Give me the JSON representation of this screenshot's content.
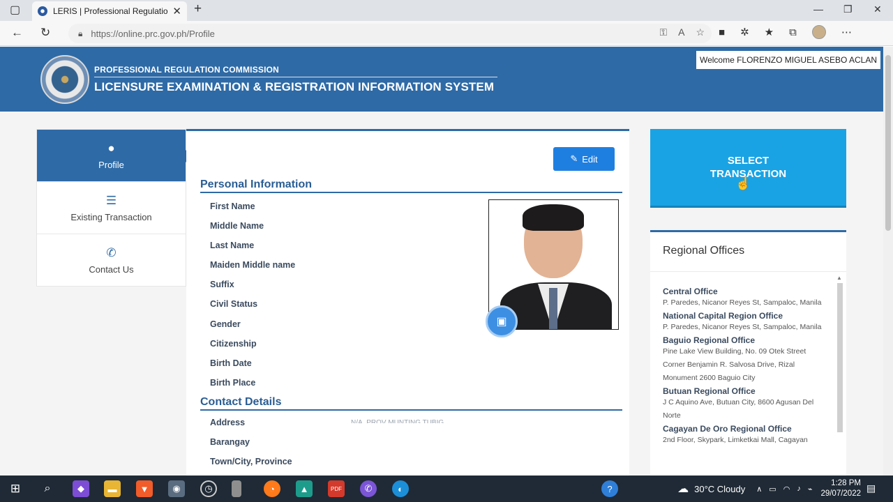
{
  "browser": {
    "tab_title": "LERIS | Professional Regulation C",
    "url": "https://online.prc.gov.ph/Profile"
  },
  "header": {
    "subtitle": "PROFESSIONAL REGULATION COMMISSION",
    "title": "LICENSURE EXAMINATION & REGISTRATION INFORMATION SYSTEM",
    "welcome": "Welcome FLORENZO MIGUEL ASEBO ACLAN"
  },
  "sidenav": {
    "items": [
      {
        "label": "Profile",
        "icon": "user-icon"
      },
      {
        "label": "Existing Transaction",
        "icon": "list-icon"
      },
      {
        "label": "Contact Us",
        "icon": "phone-icon"
      }
    ]
  },
  "profile": {
    "edit_label": "Edit",
    "personal_title": "Personal Information",
    "personal_fields": [
      "First Name",
      "Middle Name",
      "Last Name",
      "Maiden Middle name",
      "Suffix",
      "Civil Status",
      "Gender",
      "Citizenship",
      "Birth Date",
      "Birth Place"
    ],
    "contact_title": "Contact Details",
    "contact_fields": [
      "Address",
      "Barangay",
      "Town/City, Province"
    ],
    "address_value_partial": "N/A, PROV MUNTING TUBIG"
  },
  "select_transaction": "SELECT TRANSACTION",
  "regional": {
    "title": "Regional Offices",
    "offices": [
      {
        "name": "Central Office",
        "address": "P. Paredes, Nicanor Reyes St, Sampaloc, Manila"
      },
      {
        "name": "National Capital Region Office",
        "address": "P. Paredes, Nicanor Reyes St, Sampaloc, Manila"
      },
      {
        "name": "Baguio Regional Office",
        "address": "Pine Lake View Building, No. 09 Otek Street Corner Benjamin R. Salvosa Drive, Rizal Monument 2600 Baguio City"
      },
      {
        "name": "Butuan Regional Office",
        "address": "J C Aquino Ave, Butuan City, 8600 Agusan Del Norte"
      },
      {
        "name": "Cagayan De Oro Regional Office",
        "address": "2nd Floor, Skypark, Limketkai Mall, Cagayan"
      }
    ]
  },
  "taskbar": {
    "weather": "30°C  Cloudy",
    "time": "1:28 PM",
    "date": "29/07/2022"
  }
}
